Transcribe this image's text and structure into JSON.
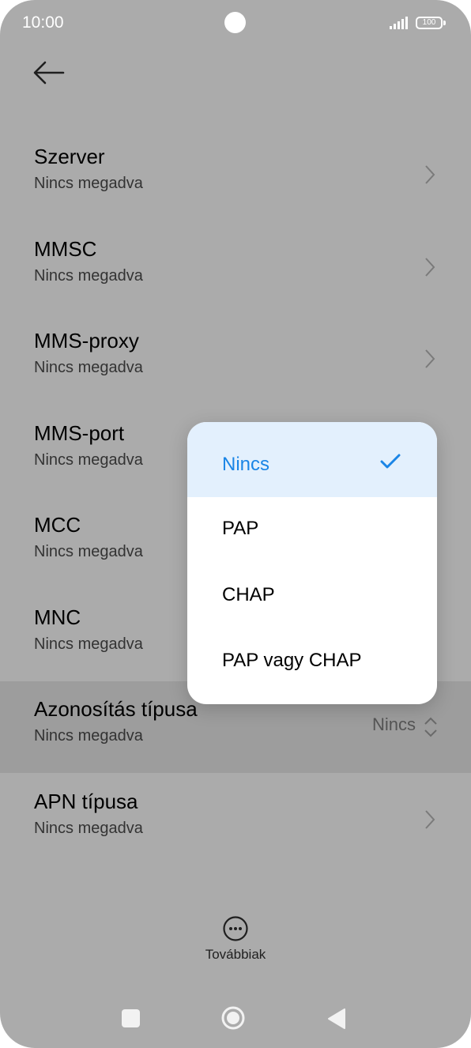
{
  "status": {
    "time": "10:00",
    "battery": "100"
  },
  "rows": [
    {
      "title": "Szerver",
      "subtitle": "Nincs megadva"
    },
    {
      "title": "MMSC",
      "subtitle": "Nincs megadva"
    },
    {
      "title": "MMS-proxy",
      "subtitle": "Nincs megadva"
    },
    {
      "title": "MMS-port",
      "subtitle": "Nincs megadva"
    },
    {
      "title": "MCC",
      "subtitle": "Nincs megadva"
    },
    {
      "title": "MNC",
      "subtitle": "Nincs megadva"
    },
    {
      "title": "Azonosítás típusa",
      "subtitle": "Nincs megadva",
      "value": "Nincs"
    },
    {
      "title": "APN típusa",
      "subtitle": "Nincs megadva"
    }
  ],
  "dropdown": {
    "options": [
      "Nincs",
      "PAP",
      "CHAP",
      "PAP vagy CHAP"
    ],
    "selected": "Nincs"
  },
  "more": {
    "label": "Továbbiak"
  },
  "icons": {
    "back": "back-arrow-icon",
    "chevron": "chevron-right-icon",
    "updown": "chevron-up-down-icon",
    "check": "checkmark-icon",
    "more": "more-dots-icon"
  },
  "colors": {
    "accent": "#1a85e6",
    "selected_bg": "#e3f0fd",
    "overlay": "#ababab"
  }
}
